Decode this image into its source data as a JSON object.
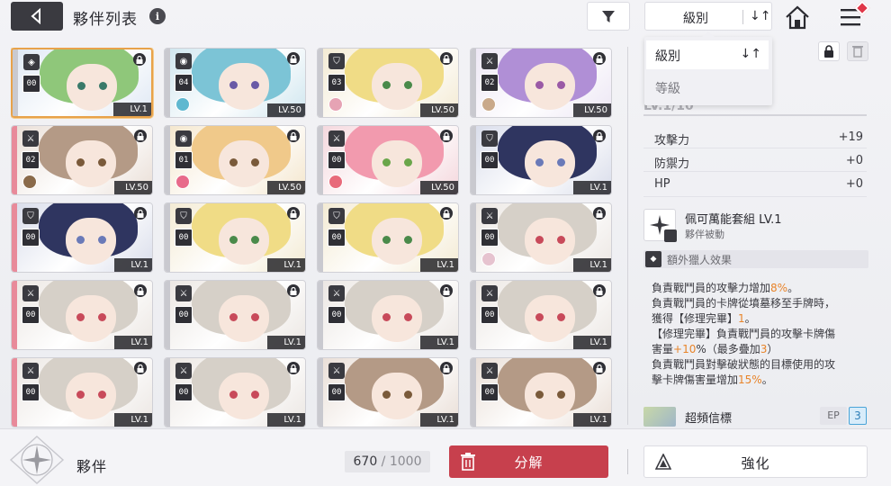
{
  "header": {
    "title": "夥伴列表",
    "info_glyph": "i",
    "sort_label": "級別",
    "sort_order_glyph": "↓↑"
  },
  "sort_dropdown": {
    "options": [
      {
        "label": "級別",
        "selected": true
      },
      {
        "label": "等級",
        "selected": false
      }
    ]
  },
  "cards": [
    {
      "star": "00",
      "level": "LV.1",
      "class": "knight",
      "hair": "#8fc77a",
      "eyes": "#3a7a6a",
      "bg": "#dfe8f4",
      "strip": "#c9c9cf",
      "selected": true,
      "has_sub": false
    },
    {
      "star": "04",
      "level": "LV.50",
      "class": "orb",
      "hair": "#7cc4d6",
      "eyes": "#6a5aa6",
      "bg": "#cfe6ef",
      "strip": "#c9c9cf",
      "selected": false,
      "has_sub": true,
      "sub": "#5fb8d0"
    },
    {
      "star": "03",
      "level": "LV.50",
      "class": "shield",
      "hair": "#f0dc86",
      "eyes": "#4a8a4a",
      "bg": "#f3ead2",
      "strip": "#c9c9cf",
      "selected": false,
      "has_sub": true,
      "sub": "#e6a3b4"
    },
    {
      "star": "02",
      "level": "LV.50",
      "class": "sword",
      "hair": "#b08fd6",
      "eyes": "#9a5aa6",
      "bg": "#ece6f4",
      "strip": "#c9c9cf",
      "selected": false,
      "has_sub": true,
      "sub": "#c9a98a"
    },
    {
      "star": "02",
      "level": "LV.50",
      "class": "sword",
      "hair": "#b49a86",
      "eyes": "#7a5a3a",
      "bg": "#e9ded6",
      "strip": "#e88a9a",
      "selected": false,
      "has_sub": true,
      "sub": "#8a6a4a"
    },
    {
      "star": "01",
      "level": "LV.50",
      "class": "orb",
      "hair": "#f0c98a",
      "eyes": "#7a5a3a",
      "bg": "#f4e6cc",
      "strip": "#c9c9cf",
      "selected": false,
      "has_sub": true,
      "sub": "#e86a8a"
    },
    {
      "star": "00",
      "level": "LV.50",
      "class": "sword",
      "hair": "#f29aae",
      "eyes": "#6aa64a",
      "bg": "#f4d6dc",
      "strip": "#c9c9cf",
      "selected": false,
      "has_sub": true,
      "sub": "#e86a7a"
    },
    {
      "star": "00",
      "level": "LV.1",
      "class": "shield",
      "hair": "#2f3560",
      "eyes": "#6a7ab8",
      "bg": "#d8dcea",
      "strip": "#c9c9cf",
      "selected": false,
      "has_sub": false
    },
    {
      "star": "00",
      "level": "LV.1",
      "class": "shield",
      "hair": "#2f3560",
      "eyes": "#6a7ab8",
      "bg": "#d8dcea",
      "strip": "#e88a9a",
      "selected": false,
      "has_sub": false
    },
    {
      "star": "00",
      "level": "LV.1",
      "class": "shield",
      "hair": "#f0dc86",
      "eyes": "#4a8a4a",
      "bg": "#f3ead2",
      "strip": "#c9c9cf",
      "selected": false,
      "has_sub": false
    },
    {
      "star": "00",
      "level": "LV.1",
      "class": "shield",
      "hair": "#f0dc86",
      "eyes": "#4a8a4a",
      "bg": "#f3ead2",
      "strip": "#c9c9cf",
      "selected": false,
      "has_sub": false
    },
    {
      "star": "00",
      "level": "LV.1",
      "class": "sword",
      "hair": "#d6d0c8",
      "eyes": "#c84a5a",
      "bg": "#ebe6e2",
      "strip": "#c9c9cf",
      "selected": false,
      "has_sub": true,
      "sub": "#e6c3cf"
    },
    {
      "star": "00",
      "level": "LV.1",
      "class": "sword",
      "hair": "#d6d0c8",
      "eyes": "#c84a5a",
      "bg": "#ebe6e2",
      "strip": "#e88a9a",
      "selected": false,
      "has_sub": false
    },
    {
      "star": "00",
      "level": "LV.1",
      "class": "sword",
      "hair": "#d6d0c8",
      "eyes": "#c84a5a",
      "bg": "#ebe6e2",
      "strip": "#c9c9cf",
      "selected": false,
      "has_sub": false
    },
    {
      "star": "00",
      "level": "LV.1",
      "class": "sword",
      "hair": "#d6d0c8",
      "eyes": "#c84a5a",
      "bg": "#ebe6e2",
      "strip": "#c9c9cf",
      "selected": false,
      "has_sub": false
    },
    {
      "star": "00",
      "level": "LV.1",
      "class": "sword",
      "hair": "#d6d0c8",
      "eyes": "#c84a5a",
      "bg": "#ebe6e2",
      "strip": "#c9c9cf",
      "selected": false,
      "has_sub": false
    },
    {
      "star": "00",
      "level": "LV.1",
      "class": "sword",
      "hair": "#d6d0c8",
      "eyes": "#c84a5a",
      "bg": "#ebe6e2",
      "strip": "#e88a9a",
      "selected": false,
      "has_sub": false
    },
    {
      "star": "00",
      "level": "LV.1",
      "class": "sword",
      "hair": "#d6d0c8",
      "eyes": "#c84a5a",
      "bg": "#ebe6e2",
      "strip": "#c9c9cf",
      "selected": false,
      "has_sub": false
    },
    {
      "star": "00",
      "level": "LV.1",
      "class": "sword",
      "hair": "#b49a86",
      "eyes": "#7a5a3a",
      "bg": "#e9ded6",
      "strip": "#c9c9cf",
      "selected": false,
      "has_sub": false
    },
    {
      "star": "00",
      "level": "LV.1",
      "class": "sword",
      "hair": "#b49a86",
      "eyes": "#7a5a3a",
      "bg": "#e9ded6",
      "strip": "#c9c9cf",
      "selected": false,
      "has_sub": false
    }
  ],
  "panel": {
    "level_text": "LV.1/10",
    "stats": [
      {
        "label": "攻擊力",
        "value": "+19"
      },
      {
        "label": "防禦力",
        "value": "+0"
      },
      {
        "label": "HP",
        "value": "+0"
      }
    ],
    "skill": {
      "name": "佩可萬能套組 LV.1",
      "type": "夥伴被動"
    },
    "extra_label": "額外獵人效果",
    "desc_lines": [
      [
        {
          "t": "負責戰鬥員的攻擊力增加"
        },
        {
          "t": "8%",
          "hl": true
        },
        {
          "t": "。"
        }
      ],
      [
        {
          "t": "負責戰鬥員的卡牌從墳墓移至手牌時，"
        }
      ],
      [
        {
          "t": "獲得【修理完畢】"
        },
        {
          "t": "1",
          "hl": true
        },
        {
          "t": "。"
        }
      ],
      [
        {
          "t": "【修理完畢】負責戰鬥員的攻擊卡牌傷"
        }
      ],
      [
        {
          "t": "害量"
        },
        {
          "t": "+10",
          "hl": true
        },
        {
          "t": "%（最多疊加"
        },
        {
          "t": "3",
          "hl": true
        },
        {
          "t": "）"
        }
      ],
      [
        {
          "t": "負責戰鬥員對擊破狀態的目標使用的攻"
        }
      ],
      [
        {
          "t": "擊卡牌傷害量增加"
        },
        {
          "t": "15%",
          "hl": true
        },
        {
          "t": "。"
        }
      ]
    ],
    "partner_name": "超頻信標",
    "ep_label": "EP",
    "ep_value": "3"
  },
  "footer": {
    "title": "夥伴",
    "count": "670",
    "count_sep": " / ",
    "count_max": "1000",
    "dismantle_label": "分解",
    "enhance_label": "強化"
  },
  "colors": {
    "dismantle": "#c7404d",
    "highlight": "#e8842a",
    "selected_border": "#e8a24a",
    "ep_accent": "#4aa4d8"
  }
}
